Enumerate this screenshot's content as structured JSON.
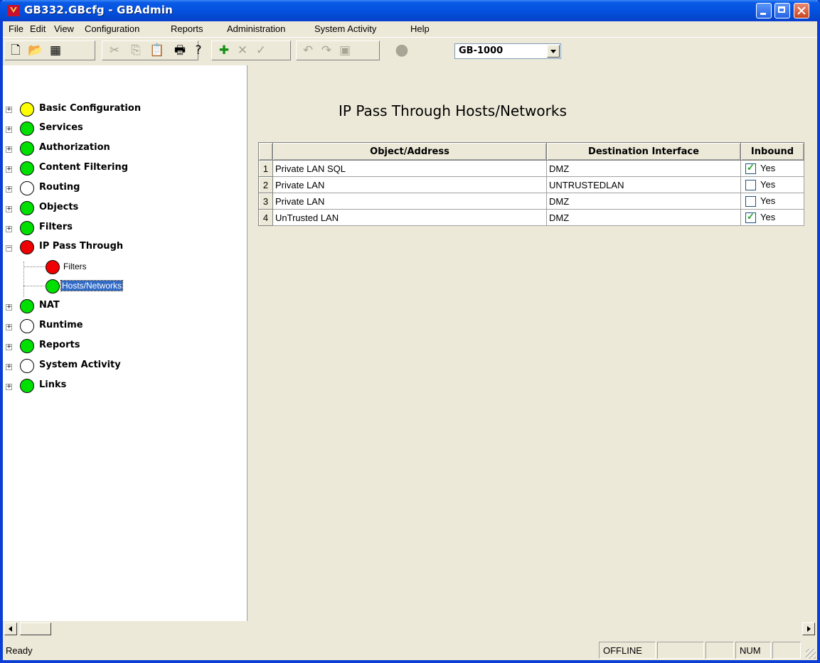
{
  "window": {
    "title": "GB332.GBcfg - GBAdmin"
  },
  "menu": [
    "File",
    "Edit",
    "View",
    "Configuration",
    "Reports",
    "Administration",
    "System Activity",
    "Help"
  ],
  "toolbar": {
    "device_select": "GB-1000"
  },
  "tree": {
    "nodes": [
      {
        "label": "Basic Configuration",
        "status": "yellow"
      },
      {
        "label": "Services",
        "status": "green"
      },
      {
        "label": "Authorization",
        "status": "green"
      },
      {
        "label": "Content Filtering",
        "status": "green"
      },
      {
        "label": "Routing",
        "status": "none"
      },
      {
        "label": "Objects",
        "status": "green"
      },
      {
        "label": "Filters",
        "status": "green"
      },
      {
        "label": "IP Pass Through",
        "status": "red"
      },
      {
        "label": "Filters",
        "status": "red"
      },
      {
        "label": "Hosts/Networks",
        "status": "green"
      },
      {
        "label": "NAT",
        "status": "green"
      },
      {
        "label": "Runtime",
        "status": "none"
      },
      {
        "label": "Reports",
        "status": "green"
      },
      {
        "label": "System Activity",
        "status": "none"
      },
      {
        "label": "Links",
        "status": "green"
      }
    ]
  },
  "main": {
    "title": "IP Pass Through Hosts/Networks",
    "columns": [
      "Object/Address",
      "Destination Interface",
      "Inbound"
    ],
    "rows": [
      {
        "num": "1",
        "object": "Private LAN SQL",
        "dest": "DMZ",
        "inbound_checked": true,
        "inbound_label": "Yes"
      },
      {
        "num": "2",
        "object": "Private LAN",
        "dest": "UNTRUSTEDLAN",
        "inbound_checked": false,
        "inbound_label": "Yes"
      },
      {
        "num": "3",
        "object": "Private LAN",
        "dest": "DMZ",
        "inbound_checked": false,
        "inbound_label": "Yes"
      },
      {
        "num": "4",
        "object": "UnTrusted LAN",
        "dest": "DMZ",
        "inbound_checked": true,
        "inbound_label": "Yes"
      }
    ]
  },
  "status": {
    "ready": "Ready",
    "mode": "OFFLINE",
    "num": "NUM"
  },
  "colors": {
    "titlebar": "#0451E0",
    "selection": "#316AC5",
    "status_yellow": "#FFFF00",
    "status_green": "#00E000",
    "status_red": "#F00000",
    "check_green": "#21A121"
  }
}
